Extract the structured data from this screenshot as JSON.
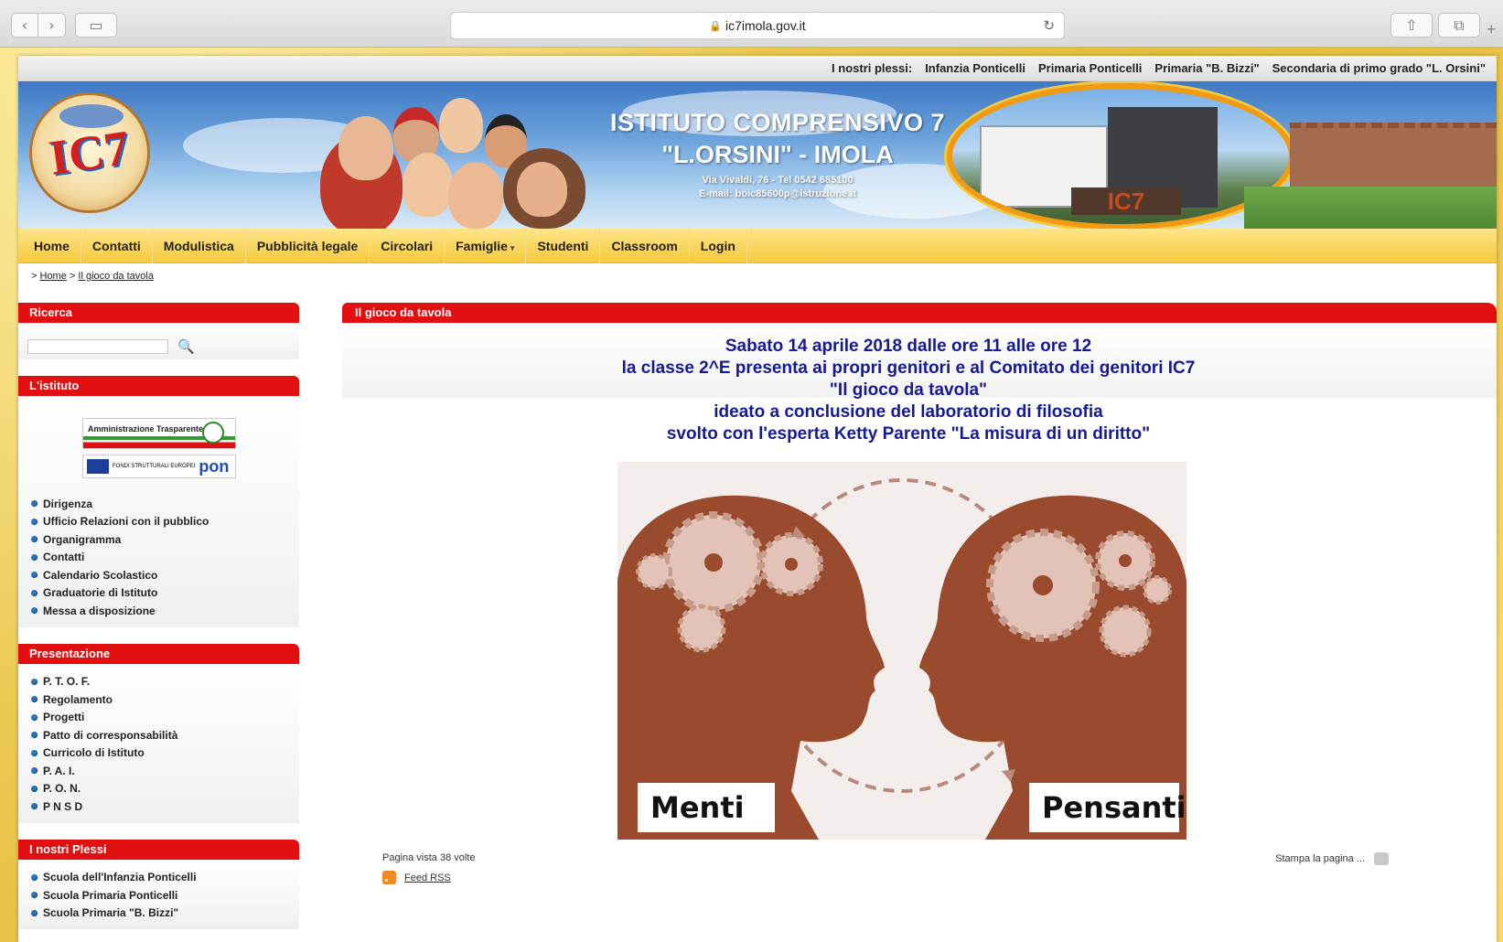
{
  "browser": {
    "url": "ic7imola.gov.it",
    "back_icon": "‹",
    "forward_icon": "›",
    "reload_icon": "↻",
    "lock_icon": "🔒",
    "share_icon": "⇧",
    "tabs_icon": "⧉",
    "sidebar_icon": "▭",
    "newtab_icon": "+"
  },
  "topbar": {
    "label": "I nostri plessi:",
    "links": [
      "Infanzia Ponticelli",
      "Primaria Ponticelli",
      "Primaria \"B. Bizzi\"",
      "Secondaria di primo grado \"L. Orsini\""
    ]
  },
  "banner": {
    "title1": "ISTITUTO COMPRENSIVO 7",
    "title2": "\"L.ORSINI\" - IMOLA",
    "address": "Via Vivaldi, 76 - Tel 0542 685100",
    "email": "E-mail: boic85600p@istruzione.it",
    "logo_text": "IC7",
    "building_sign": "IC7"
  },
  "nav": {
    "items": [
      "Home",
      "Contatti",
      "Modulistica",
      "Pubblicità legale",
      "Circolari",
      "Famiglie",
      "Studenti",
      "Classroom",
      "Login"
    ],
    "dropdown_caret": "▾"
  },
  "breadcrumb": {
    "sep": ">",
    "home": "Home",
    "current": "Il gioco da tavola"
  },
  "sidebar": {
    "search_title": "Ricerca",
    "search_icon": "🔍",
    "istituto_title": "L'istituto",
    "badge1": "Amministrazione Trasparente",
    "badge2_text": "FONDI STRUTTURALI EUROPEI",
    "badge2_pon": "pon",
    "istituto_items": [
      "Dirigenza",
      "Ufficio Relazioni con il pubblico",
      "Organigramma",
      "Contatti",
      "Calendario Scolastico",
      "Graduatorie di Istituto",
      "Messa a disposizione"
    ],
    "presentazione_title": "Presentazione",
    "presentazione_items": [
      "P. T. O. F.",
      "Regolamento",
      "Progetti",
      "Patto di corresponsabilità",
      "Curricolo di Istituto",
      "P. A. I.",
      "P. O. N.",
      "P N S D"
    ],
    "plessi_title": "I nostri Plessi",
    "plessi_items": [
      "Scuola dell'Infanzia Ponticelli",
      "Scuola Primaria Ponticelli",
      "Scuola Primaria \"B. Bizzi\""
    ]
  },
  "main": {
    "title": "Il gioco da tavola",
    "lines": [
      "Sabato 14 aprile 2018 dalle ore 11 alle ore 12",
      "la classe 2^E presenta ai  propri genitori e al Comitato dei genitori IC7",
      "\"Il gioco da tavola\"",
      "ideato  a conclusione del laboratorio di filosofia",
      "svolto con l'esperta Ketty Parente \"La misura di un diritto\""
    ],
    "poster_left": "Menti",
    "poster_right": "Pensanti",
    "views": "Pagina vista 38 volte",
    "rss": "Feed RSS",
    "print": "Stampa la pagina ..."
  },
  "colors": {
    "accent_red": "#e10f0f",
    "nav_yellow": "#f5c93c",
    "text_blue": "#161a8e",
    "head_brown": "#8c3b22"
  }
}
